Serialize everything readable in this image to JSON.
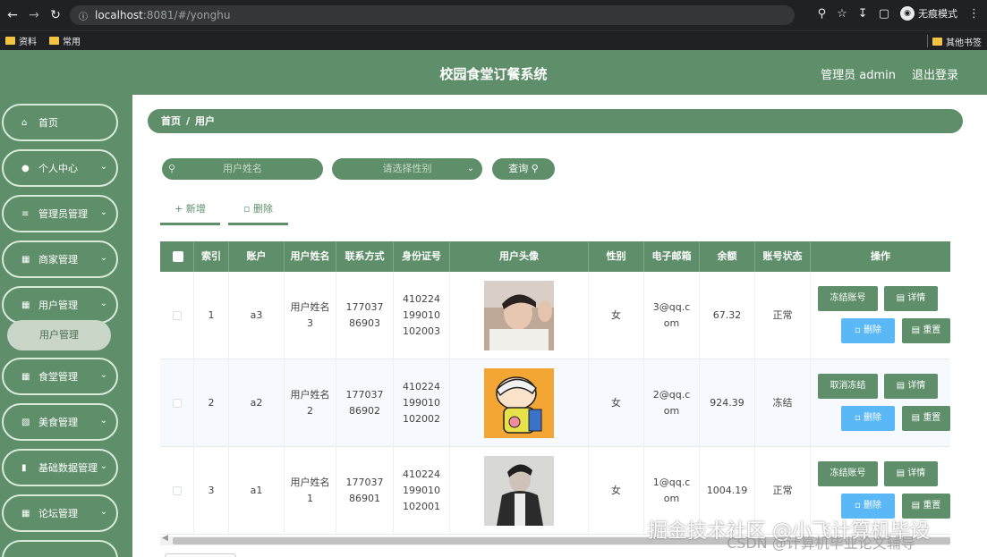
{
  "browser": {
    "back_icon": "arrow-left-icon",
    "forward_icon": "arrow-right-icon",
    "reload_icon": "reload-icon",
    "url_host": "localhost",
    "url_path": ":8081/#/yonghu",
    "incognito_label": "无痕模式",
    "bookmarks": [
      "资料",
      "常用"
    ],
    "other_bookmarks": "其他书签"
  },
  "header": {
    "title": "校园食堂订餐系统",
    "admin_label": "管理员 admin",
    "logout_label": "退出登录"
  },
  "sidebar": {
    "items": [
      {
        "label": "首页",
        "icon": "home-icon",
        "chevron": false
      },
      {
        "label": "个人中心",
        "icon": "user-icon",
        "chevron": true
      },
      {
        "label": "管理员管理",
        "icon": "menu-icon",
        "chevron": true
      },
      {
        "label": "商家管理",
        "icon": "grid-icon",
        "chevron": true
      },
      {
        "label": "用户管理",
        "icon": "grid-icon",
        "chevron": true
      },
      {
        "label": "食堂管理",
        "icon": "grid-icon",
        "chevron": true
      },
      {
        "label": "美食管理",
        "icon": "table-icon",
        "chevron": true
      },
      {
        "label": "基础数据管理",
        "icon": "clipboard-icon",
        "chevron": true
      },
      {
        "label": "论坛管理",
        "icon": "grid-icon",
        "chevron": true
      }
    ],
    "active_sub": "用户管理"
  },
  "breadcrumb": {
    "home": "首页",
    "sep": "/",
    "current": "用户"
  },
  "search": {
    "name_placeholder": "用户姓名",
    "gender_placeholder": "请选择性别",
    "query_label": "查询"
  },
  "toolbar": {
    "add_label": "+ 新增",
    "delete_label": "删除"
  },
  "table": {
    "columns": [
      "索引",
      "账户",
      "用户姓名",
      "联系方式",
      "身份证号",
      "用户头像",
      "性别",
      "电子邮箱",
      "余额",
      "账号状态",
      "操作"
    ],
    "rows": [
      {
        "index": "1",
        "account": "a3",
        "name": "用户姓名3",
        "phone": "17703786903",
        "id_card": "410224199010102003",
        "gender": "女",
        "email": "3@qq.com",
        "balance": "67.32",
        "status": "正常",
        "freeze_label": "冻结账号",
        "detail_label": "详情",
        "delete_label": "删除",
        "reset_label": "重置"
      },
      {
        "index": "2",
        "account": "a2",
        "name": "用户姓名2",
        "phone": "17703786902",
        "id_card": "410224199010102002",
        "gender": "女",
        "email": "2@qq.com",
        "balance": "924.39",
        "status": "冻结",
        "freeze_label": "取消冻结",
        "detail_label": "详情",
        "delete_label": "删除",
        "reset_label": "重置"
      },
      {
        "index": "3",
        "account": "a1",
        "name": "用户姓名1",
        "phone": "17703786901",
        "id_card": "410224199010102001",
        "gender": "女",
        "email": "1@qq.com",
        "balance": "1004.19",
        "status": "正常",
        "freeze_label": "冻结账号",
        "detail_label": "详情",
        "delete_label": "删除",
        "reset_label": "重置"
      }
    ]
  },
  "watermark": {
    "main": "掘金技术社区 @小飞计算机毕设",
    "sub": "CSDN @计算机毕业论文辅导"
  },
  "colors": {
    "primary": "#5e8f6a",
    "blue": "#59b8f5"
  }
}
